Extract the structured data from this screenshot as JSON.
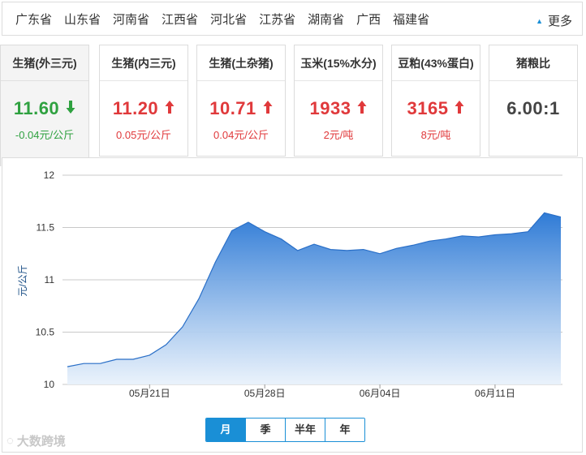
{
  "provinces": [
    "广东省",
    "山东省",
    "河南省",
    "江西省",
    "河北省",
    "江苏省",
    "湖南省",
    "广西",
    "福建省"
  ],
  "more_label": "更多",
  "cards": [
    {
      "title": "生猪(外三元)",
      "value": "11.60",
      "direction": "down",
      "change": "-0.04元/公斤",
      "active": true
    },
    {
      "title": "生猪(内三元)",
      "value": "11.20",
      "direction": "up",
      "change": "0.05元/公斤",
      "active": false
    },
    {
      "title": "生猪(土杂猪)",
      "value": "10.71",
      "direction": "up",
      "change": "0.04元/公斤",
      "active": false
    },
    {
      "title": "玉米(15%水分)",
      "value": "1933",
      "direction": "up",
      "change": "2元/吨",
      "active": false
    },
    {
      "title": "豆粕(43%蛋白)",
      "value": "3165",
      "direction": "up",
      "change": "8元/吨",
      "active": false
    },
    {
      "title": "猪粮比",
      "value": "6.00:1",
      "direction": "none",
      "change": "",
      "active": false
    }
  ],
  "range_buttons": [
    {
      "label": "月",
      "active": true
    },
    {
      "label": "季",
      "active": false
    },
    {
      "label": "半年",
      "active": false
    },
    {
      "label": "年",
      "active": false
    }
  ],
  "watermark": "大数跨境",
  "colors": {
    "up": "#e0393b",
    "down": "#2fa140",
    "accent": "#1a8fd6",
    "area_top": "#2f7bd6",
    "area_bottom": "#e8f1fb"
  },
  "chart_data": {
    "type": "area",
    "title": "",
    "xlabel": "",
    "ylabel": "元/公斤",
    "ylim": [
      10,
      12
    ],
    "yticks": [
      "10",
      "10.5",
      "11",
      "11.5",
      "12"
    ],
    "xticks": [
      {
        "label": "05月21日",
        "day": 5
      },
      {
        "label": "05月28日",
        "day": 12
      },
      {
        "label": "06月04日",
        "day": 19
      },
      {
        "label": "06月11日",
        "day": 26
      }
    ],
    "grid": true,
    "series": [
      {
        "values": [
          10.17,
          10.2,
          10.2,
          10.24,
          10.24,
          10.28,
          10.38,
          10.55,
          10.82,
          11.17,
          11.47,
          11.55,
          11.46,
          11.39,
          11.28,
          11.34,
          11.29,
          11.28,
          11.29,
          11.25,
          11.3,
          11.33,
          11.37,
          11.39,
          11.42,
          11.41,
          11.43,
          11.44,
          11.46,
          11.64,
          11.6
        ]
      }
    ]
  }
}
